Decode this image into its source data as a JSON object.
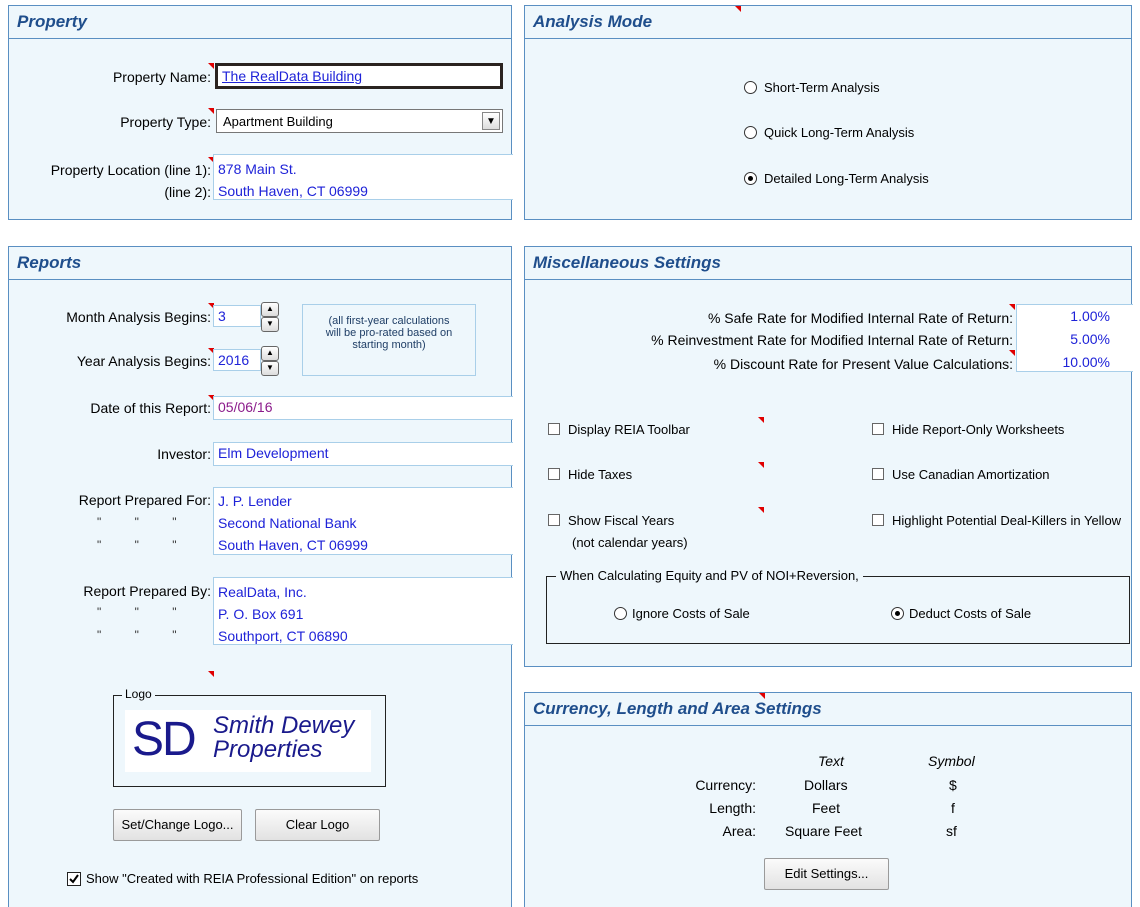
{
  "property": {
    "title": "Property",
    "name_label": "Property Name:",
    "name_value": "The RealData Building",
    "type_label": "Property Type:",
    "type_value": "Apartment Building",
    "location1_label": "Property Location (line 1):",
    "location2_label": "(line 2):",
    "location1_value": "878 Main St.",
    "location2_value": "South Haven, CT 06999"
  },
  "analysis_mode": {
    "title": "Analysis Mode",
    "options": [
      "Short-Term Analysis",
      "Quick Long-Term Analysis",
      "Detailed Long-Term Analysis"
    ],
    "selected": "Detailed Long-Term Analysis"
  },
  "reports": {
    "title": "Reports",
    "month_label": "Month Analysis Begins:",
    "month_value": "3",
    "year_label": "Year Analysis Begins:",
    "year_value": "2016",
    "note": [
      "(all first-year calculations",
      "will be pro-rated based on",
      "starting month)"
    ],
    "date_label": "Date of this Report:",
    "date_value": "05/06/16",
    "investor_label": "Investor:",
    "investor_value": "Elm Development",
    "prepared_for_label": "Report Prepared For:",
    "prepared_for": [
      "J. P. Lender",
      "Second National Bank",
      "South Haven, CT 06999"
    ],
    "prepared_by_label": "Report Prepared By:",
    "prepared_by": [
      "RealData, Inc.",
      "P. O. Box 691",
      "Southport, CT 06890"
    ],
    "ditto": "\"          \"          \"",
    "logo_label": "Logo",
    "logo_initials": "SD",
    "logo_line1": "Smith Dewey",
    "logo_line2": "Properties",
    "set_logo_button": "Set/Change Logo...",
    "clear_logo_button": "Clear Logo",
    "show_created_label": "Show \"Created with REIA Professional Edition\" on reports",
    "show_created_checked": true
  },
  "misc": {
    "title": "Miscellaneous Settings",
    "rates": [
      {
        "label": "% Safe Rate for Modified Internal Rate of Return:",
        "value": "1.00%"
      },
      {
        "label": "% Reinvestment Rate for Modified Internal Rate of Return:",
        "value": "5.00%"
      },
      {
        "label": "% Discount Rate for Present Value Calculations:",
        "value": "10.00%"
      }
    ],
    "checkboxes_left": [
      "Display REIA Toolbar",
      "Hide Taxes",
      "Show Fiscal Years"
    ],
    "fiscal_note": "(not calendar years)",
    "checkboxes_right": [
      "Hide Report-Only Worksheets",
      "Use Canadian Amortization",
      "Highlight Potential Deal-Killers in Yellow"
    ],
    "group_title": "When Calculating Equity and PV of NOI+Reversion,",
    "group_options": [
      "Ignore Costs of Sale",
      "Deduct Costs of Sale"
    ],
    "group_selected": "Deduct Costs of Sale"
  },
  "currency": {
    "title": "Currency, Length and Area Settings",
    "col_text": "Text",
    "col_symbol": "Symbol",
    "rows": [
      {
        "label": "Currency:",
        "text": "Dollars",
        "symbol": "$"
      },
      {
        "label": "Length:",
        "text": "Feet",
        "symbol": "f"
      },
      {
        "label": "Area:",
        "text": "Square Feet",
        "symbol": "sf"
      }
    ],
    "edit_button": "Edit Settings..."
  },
  "colors": {
    "panel_bg": "#eef7fc",
    "border": "#5a8fc2",
    "header_text": "#1f4e8c",
    "value_blue": "#1e22d8",
    "value_purple": "#8b1b8b",
    "marker_red": "#e00000"
  }
}
